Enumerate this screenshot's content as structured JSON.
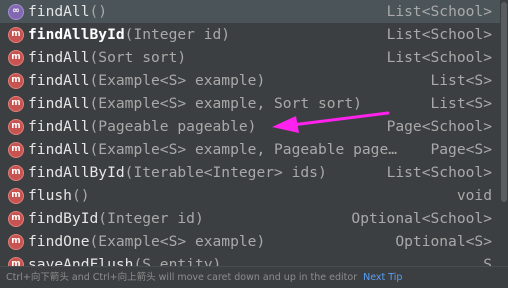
{
  "rows": [
    {
      "icon": "special-method-icon",
      "glyph": "∞",
      "name": "findAll",
      "params": "()",
      "type": "List<School>",
      "bold": false,
      "selected": true
    },
    {
      "icon": "method-icon",
      "glyph": "m",
      "name": "findAllById",
      "params": "(Integer id)",
      "type": "List<School>",
      "bold": true,
      "selected": false
    },
    {
      "icon": "method-icon",
      "glyph": "m",
      "name": "findAll",
      "params": "(Sort sort)",
      "type": "List<School>",
      "bold": false,
      "selected": false
    },
    {
      "icon": "method-icon",
      "glyph": "m",
      "name": "findAll",
      "params": "(Example<S> example)",
      "type": "List<S>",
      "bold": false,
      "selected": false
    },
    {
      "icon": "method-icon",
      "glyph": "m",
      "name": "findAll",
      "params": "(Example<S> example, Sort sort)",
      "type": "List<S>",
      "bold": false,
      "selected": false
    },
    {
      "icon": "method-icon",
      "glyph": "m",
      "name": "findAll",
      "params": "(Pageable pageable)",
      "type": "Page<School>",
      "bold": false,
      "selected": false
    },
    {
      "icon": "method-icon",
      "glyph": "m",
      "name": "findAll",
      "params": "(Example<S> example, Pageable page…",
      "type": "Page<S>",
      "bold": false,
      "selected": false
    },
    {
      "icon": "method-icon",
      "glyph": "m",
      "name": "findAllById",
      "params": "(Iterable<Integer> ids)",
      "type": "List<School>",
      "bold": false,
      "selected": false
    },
    {
      "icon": "method-icon",
      "glyph": "m",
      "name": "flush",
      "params": "()",
      "type": "void",
      "bold": false,
      "selected": false
    },
    {
      "icon": "method-icon",
      "glyph": "m",
      "name": "findById",
      "params": "(Integer id)",
      "type": "Optional<School>",
      "bold": false,
      "selected": false
    },
    {
      "icon": "method-icon",
      "glyph": "m",
      "name": "findOne",
      "params": "(Example<S> example)",
      "type": "Optional<S>",
      "bold": false,
      "selected": false
    },
    {
      "icon": "method-icon",
      "glyph": "m",
      "name": "saveAndFlush",
      "params": "(S entity)",
      "type": "S",
      "bold": false,
      "selected": false
    }
  ],
  "footer": {
    "hint": "Ctrl+向下箭头 and Ctrl+向上箭头 will move caret down and up in the editor",
    "next_tip": "Next Tip"
  },
  "colors": {
    "background": "#3c3f41",
    "selected_row": "#4b5458",
    "method_icon": "#c75450",
    "special_icon": "#8268b0",
    "annotation_arrow": "#ff22ee",
    "link": "#589df6"
  }
}
